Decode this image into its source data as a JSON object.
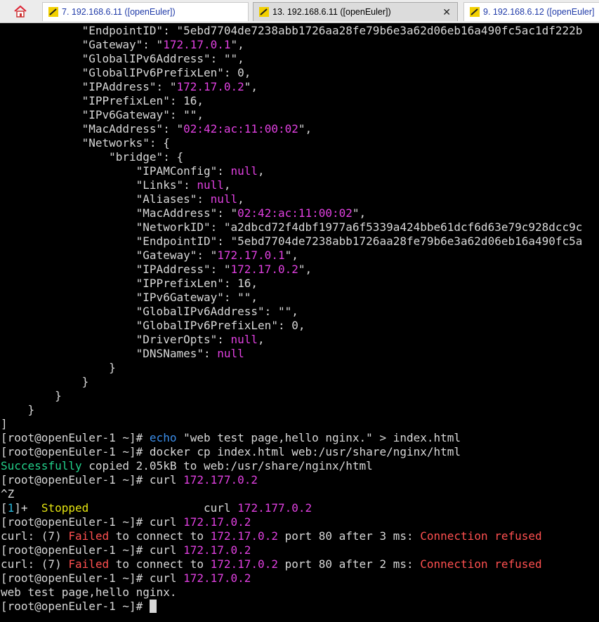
{
  "tabs": [
    {
      "label": "7. 192.168.6.11 ([openEuler])",
      "active": false,
      "closable": false
    },
    {
      "label": "13. 192.168.6.11 ([openEuler])",
      "active": true,
      "closable": true,
      "close_glyph": "✕"
    },
    {
      "label": "9. 192.168.6.12 ([openEuler]",
      "active": false,
      "closable": false
    }
  ],
  "colors": {
    "background": "#000000",
    "text": "#d8d8d8",
    "magenta": "#e040e0",
    "red": "#ff5050",
    "green": "#23d18b",
    "yellow": "#e5e510",
    "blue": "#3b8eea",
    "tab_text": "#1f3aa8"
  },
  "icons": {
    "home": "home-icon",
    "tab": "terminal-tab-icon"
  },
  "terminal": {
    "lines": [
      [
        [
          "            \"EndpointID\": \"5ebd7704de7238abb1726aa28fe79b6e3a62d06eb16a490fc5ac1df222b",
          "plain"
        ]
      ],
      [
        [
          "            \"Gateway\": \"",
          "plain"
        ],
        [
          "172.17.0.1",
          "magenta"
        ],
        [
          "\",",
          "plain"
        ]
      ],
      [
        [
          "            \"GlobalIPv6Address\": \"\",",
          "plain"
        ]
      ],
      [
        [
          "            \"GlobalIPv6PrefixLen\": 0,",
          "plain"
        ]
      ],
      [
        [
          "            \"IPAddress\": \"",
          "plain"
        ],
        [
          "172.17.0.2",
          "magenta"
        ],
        [
          "\",",
          "plain"
        ]
      ],
      [
        [
          "            \"IPPrefixLen\": 16,",
          "plain"
        ]
      ],
      [
        [
          "            \"IPv6Gateway\": \"\",",
          "plain"
        ]
      ],
      [
        [
          "            \"MacAddress\": \"",
          "plain"
        ],
        [
          "02:42:ac:11:00:02",
          "magenta"
        ],
        [
          "\",",
          "plain"
        ]
      ],
      [
        [
          "            \"Networks\": {",
          "plain"
        ]
      ],
      [
        [
          "                \"bridge\": {",
          "plain"
        ]
      ],
      [
        [
          "                    \"IPAMConfig\": ",
          "plain"
        ],
        [
          "null",
          "magenta"
        ],
        [
          ",",
          "plain"
        ]
      ],
      [
        [
          "                    \"Links\": ",
          "plain"
        ],
        [
          "null",
          "magenta"
        ],
        [
          ",",
          "plain"
        ]
      ],
      [
        [
          "                    \"Aliases\": ",
          "plain"
        ],
        [
          "null",
          "magenta"
        ],
        [
          ",",
          "plain"
        ]
      ],
      [
        [
          "                    \"MacAddress\": \"",
          "plain"
        ],
        [
          "02:42:ac:11:00:02",
          "magenta"
        ],
        [
          "\",",
          "plain"
        ]
      ],
      [
        [
          "                    \"NetworkID\": \"a2dbcd72f4dbf1977a6f5339a424bbe61dcf6d63e79c928dcc9c",
          "plain"
        ]
      ],
      [
        [
          "                    \"EndpointID\": \"5ebd7704de7238abb1726aa28fe79b6e3a62d06eb16a490fc5a",
          "plain"
        ]
      ],
      [
        [
          "                    \"Gateway\": \"",
          "plain"
        ],
        [
          "172.17.0.1",
          "magenta"
        ],
        [
          "\",",
          "plain"
        ]
      ],
      [
        [
          "                    \"IPAddress\": \"",
          "plain"
        ],
        [
          "172.17.0.2",
          "magenta"
        ],
        [
          "\",",
          "plain"
        ]
      ],
      [
        [
          "                    \"IPPrefixLen\": 16,",
          "plain"
        ]
      ],
      [
        [
          "                    \"IPv6Gateway\": \"\",",
          "plain"
        ]
      ],
      [
        [
          "                    \"GlobalIPv6Address\": \"\",",
          "plain"
        ]
      ],
      [
        [
          "                    \"GlobalIPv6PrefixLen\": 0,",
          "plain"
        ]
      ],
      [
        [
          "                    \"DriverOpts\": ",
          "plain"
        ],
        [
          "null",
          "magenta"
        ],
        [
          ",",
          "plain"
        ]
      ],
      [
        [
          "                    \"DNSNames\": ",
          "plain"
        ],
        [
          "null",
          "magenta"
        ]
      ],
      [
        [
          "                }",
          "plain"
        ]
      ],
      [
        [
          "            }",
          "plain"
        ]
      ],
      [
        [
          "        }",
          "plain"
        ]
      ],
      [
        [
          "    }",
          "plain"
        ]
      ],
      [
        [
          "]",
          "plain"
        ]
      ],
      [
        [
          "[root@openEuler-1 ~]# ",
          "plain"
        ],
        [
          "echo",
          "blue"
        ],
        [
          " \"web test page,hello nginx.\" > index.html",
          "plain"
        ]
      ],
      [
        [
          "[root@openEuler-1 ~]# docker cp index.html web:/usr/share/nginx/html",
          "plain"
        ]
      ],
      [
        [
          "Successfully",
          "green"
        ],
        [
          " copied 2.05kB to web:/usr/share/nginx/html",
          "plain"
        ]
      ],
      [
        [
          "[root@openEuler-1 ~]# curl ",
          "plain"
        ],
        [
          "172.177.0.2",
          "magenta"
        ]
      ],
      [
        [
          "^Z",
          "plain"
        ]
      ],
      [
        [
          "[",
          "plain"
        ],
        [
          "1",
          "cyan"
        ],
        [
          "]+  ",
          "plain"
        ],
        [
          "Stopped",
          "yellow"
        ],
        [
          "                 curl ",
          "plain"
        ],
        [
          "172.177.0.2",
          "magenta"
        ]
      ],
      [
        [
          "[root@openEuler-1 ~]# curl ",
          "plain"
        ],
        [
          "172.17.0.2",
          "magenta"
        ]
      ],
      [
        [
          "curl: (7) ",
          "plain"
        ],
        [
          "Failed",
          "red"
        ],
        [
          " to connect to ",
          "plain"
        ],
        [
          "172.17.0.2",
          "magenta"
        ],
        [
          " port 80 after 3 ms: ",
          "plain"
        ],
        [
          "Connection refused",
          "red"
        ]
      ],
      [
        [
          "[root@openEuler-1 ~]# curl ",
          "plain"
        ],
        [
          "172.17.0.2",
          "magenta"
        ]
      ],
      [
        [
          "curl: (7) ",
          "plain"
        ],
        [
          "Failed",
          "red"
        ],
        [
          " to connect to ",
          "plain"
        ],
        [
          "172.17.0.2",
          "magenta"
        ],
        [
          " port 80 after 2 ms: ",
          "plain"
        ],
        [
          "Connection refused",
          "red"
        ]
      ],
      [
        [
          "[root@openEuler-1 ~]# curl ",
          "plain"
        ],
        [
          "172.17.0.2",
          "magenta"
        ]
      ],
      [
        [
          "web test page,hello nginx.",
          "plain"
        ]
      ],
      [
        [
          "[root@openEuler-1 ~]# ",
          "plain"
        ]
      ]
    ]
  }
}
